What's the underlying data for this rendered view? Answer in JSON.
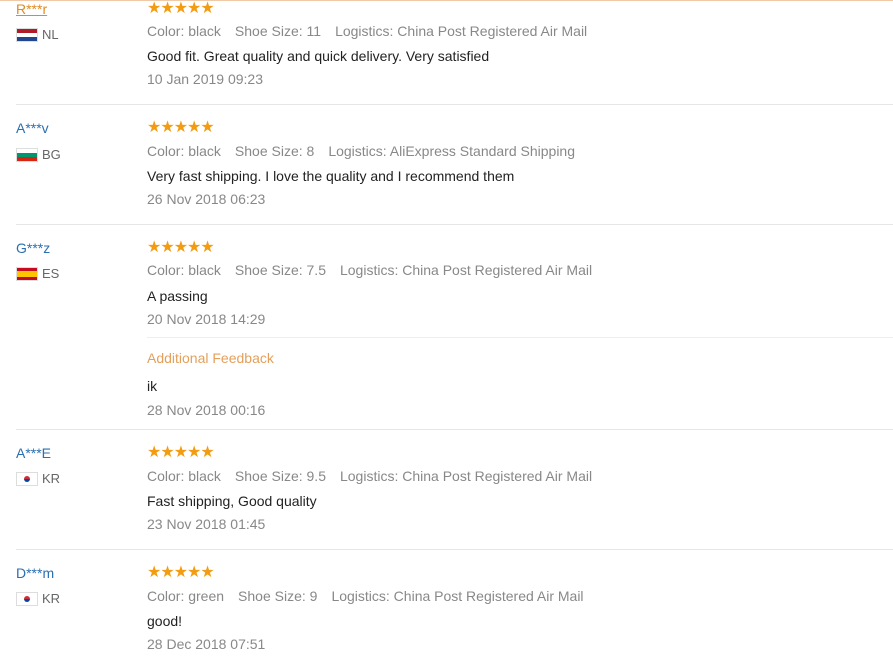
{
  "reviews": [
    {
      "user": "R***r",
      "country": "NL",
      "rating": 5,
      "color": "Color: black",
      "size": "Shoe Size: 11",
      "logistics": "Logistics: China Post Registered Air Mail",
      "text": "Good fit. Great quality and quick delivery. Very satisfied",
      "date": "10 Jan 2019 09:23"
    },
    {
      "user": "A***v",
      "country": "BG",
      "rating": 5,
      "color": "Color: black",
      "size": "Shoe Size: 8",
      "logistics": "Logistics: AliExpress Standard Shipping",
      "text": "Very fast shipping. I love the quality and I recommend them",
      "date": "26 Nov 2018 06:23"
    },
    {
      "user": "G***z",
      "country": "ES",
      "rating": 5,
      "color": "Color: black",
      "size": "Shoe Size: 7.5",
      "logistics": "Logistics: China Post Registered Air Mail",
      "text": "A passing",
      "date": "20 Nov 2018 14:29",
      "additional_label": "Additional Feedback",
      "additional_text": "ik",
      "additional_date": "28 Nov 2018 00:16"
    },
    {
      "user": "A***E",
      "country": "KR",
      "rating": 5,
      "color": "Color: black",
      "size": "Shoe Size: 9.5",
      "logistics": "Logistics: China Post Registered Air Mail",
      "text": "Fast shipping, Good quality",
      "date": "23 Nov 2018 01:45"
    },
    {
      "user": "D***m",
      "country": "KR",
      "rating": 5,
      "color": "Color: green",
      "size": "Shoe Size: 9",
      "logistics": "Logistics: China Post Registered Air Mail",
      "text": "good!",
      "date": "28 Dec 2018 07:51"
    }
  ],
  "stars_glyph": "★★★★★",
  "colors": {
    "star": "#f39c12",
    "user_link": "#2a6fb1",
    "active_link": "#e28a22",
    "additional": "#e4a05a"
  }
}
